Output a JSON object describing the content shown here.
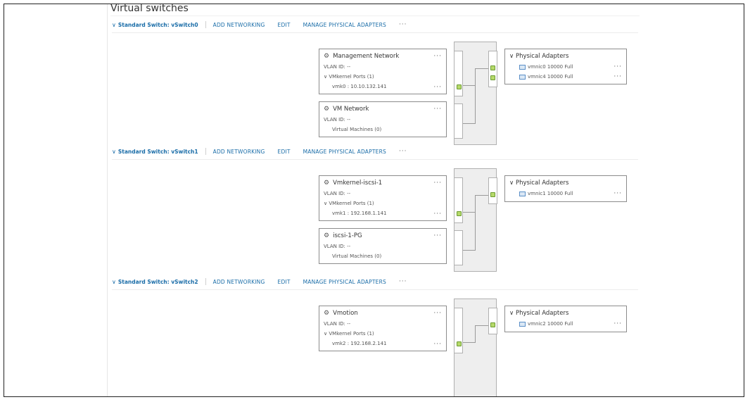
{
  "page": {
    "title": "Virtual switches"
  },
  "actions": {
    "add": "ADD NETWORKING",
    "edit": "EDIT",
    "manage": "MANAGE PHYSICAL ADAPTERS",
    "more": "···"
  },
  "switches": [
    {
      "name": "Standard Switch: vSwitch0",
      "port_groups": [
        {
          "name": "Management Network",
          "vlan": "VLAN ID: --",
          "detail": "VMkernel Ports (1)",
          "sub": "vmk0 : 10.10.132.141"
        },
        {
          "name": "VM Network",
          "vlan": "VLAN ID: --",
          "detail": "Virtual Machines (0)"
        }
      ],
      "adapters_title": "Physical Adapters",
      "adapters": [
        "vmnic0 10000 Full",
        "vmnic4 10000 Full"
      ]
    },
    {
      "name": "Standard Switch: vSwitch1",
      "port_groups": [
        {
          "name": "Vmkernel-iscsi-1",
          "vlan": "VLAN ID: --",
          "detail": "VMkernel Ports (1)",
          "sub": "vmk1 : 192.168.1.141"
        },
        {
          "name": "iscsi-1-PG",
          "vlan": "VLAN ID: --",
          "detail": "Virtual Machines (0)"
        }
      ],
      "adapters_title": "Physical Adapters",
      "adapters": [
        "vmnic1 10000 Full"
      ]
    },
    {
      "name": "Standard Switch: vSwitch2",
      "port_groups": [
        {
          "name": "Vmotion",
          "vlan": "VLAN ID: --",
          "detail": "VMkernel Ports (1)",
          "sub": "vmk2 : 192.168.2.141"
        }
      ],
      "adapters_title": "Physical Adapters",
      "adapters": [
        "vmnic2 10000 Full"
      ]
    }
  ]
}
